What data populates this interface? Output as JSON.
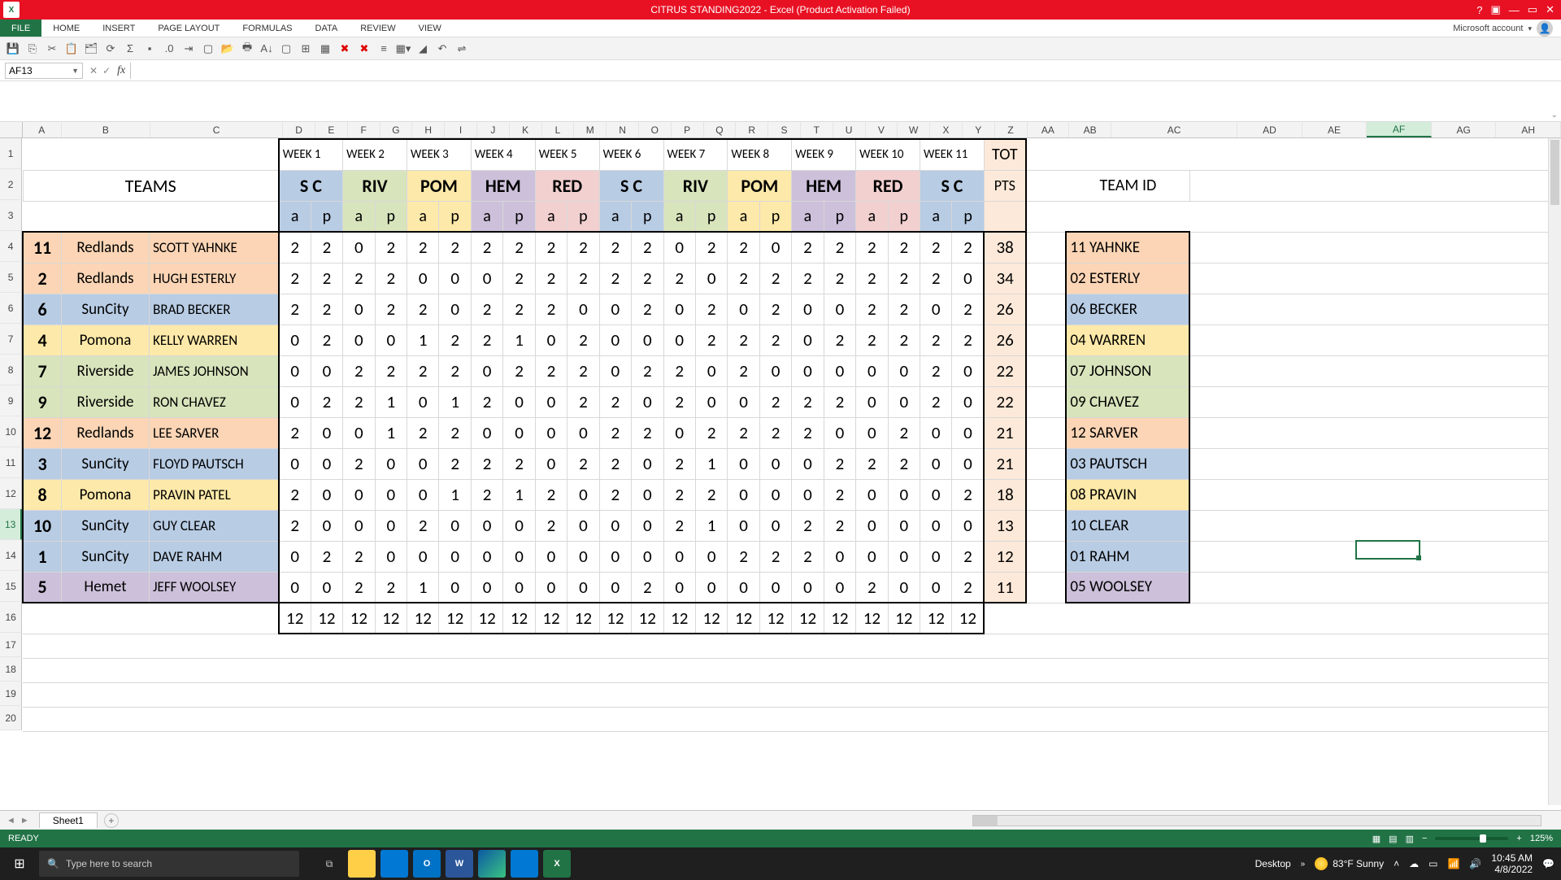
{
  "titlebar": {
    "title": "CITRUS STANDING2022 - Excel (Product Activation Failed)"
  },
  "ribbon": {
    "file": "FILE",
    "tabs": [
      "HOME",
      "INSERT",
      "PAGE LAYOUT",
      "FORMULAS",
      "DATA",
      "REVIEW",
      "VIEW"
    ],
    "account": "Microsoft account"
  },
  "namebox": "AF13",
  "columns": [
    "A",
    "B",
    "C",
    "D",
    "E",
    "F",
    "G",
    "H",
    "I",
    "J",
    "K",
    "L",
    "M",
    "N",
    "O",
    "P",
    "Q",
    "R",
    "S",
    "T",
    "U",
    "V",
    "W",
    "X",
    "Y",
    "Z",
    "AA",
    "AB",
    "AC",
    "AD",
    "AE",
    "AF",
    "AG",
    "AH"
  ],
  "row_numbers": [
    "1",
    "2",
    "3",
    "4",
    "5",
    "6",
    "7",
    "8",
    "9",
    "10",
    "11",
    "12",
    "13",
    "14",
    "15",
    "16",
    "17",
    "18",
    "19",
    "20"
  ],
  "selected_col": "AF",
  "selected_row": "13",
  "header": {
    "teams_label": "TEAMS",
    "weeks": [
      "WEEK 1",
      "WEEK 2",
      "WEEK 3",
      "WEEK 4",
      "WEEK 5",
      "WEEK 6",
      "WEEK 7",
      "WEEK 8",
      "WEEK 9",
      "WEEK 10",
      "WEEK 11"
    ],
    "locations": [
      "S C",
      "RIV",
      "POM",
      "HEM",
      "RED",
      "S C",
      "RIV",
      "POM",
      "HEM",
      "RED",
      "S C"
    ],
    "a": "a",
    "p": "p",
    "tot": "TOT",
    "pts": "PTS",
    "team_id": "TEAM ID"
  },
  "rows": [
    {
      "num": "11",
      "city": "Redlands",
      "name": "SCOTT YAHNKE",
      "scores": [
        2,
        2,
        0,
        2,
        2,
        2,
        2,
        2,
        2,
        2,
        2,
        2,
        0,
        2,
        2,
        0,
        2,
        2,
        2,
        2,
        2,
        2
      ],
      "tot": "38",
      "id": "11 YAHNKE",
      "fill": "f-orange"
    },
    {
      "num": "2",
      "city": "Redlands",
      "name": "HUGH ESTERLY",
      "scores": [
        2,
        2,
        2,
        2,
        0,
        0,
        0,
        2,
        2,
        2,
        2,
        2,
        2,
        0,
        2,
        2,
        2,
        2,
        2,
        2,
        2,
        0
      ],
      "tot": "34",
      "id": "02 ESTERLY",
      "fill": "f-orange"
    },
    {
      "num": "6",
      "city": "SunCity",
      "name": "BRAD BECKER",
      "scores": [
        2,
        2,
        0,
        2,
        2,
        0,
        2,
        2,
        2,
        0,
        0,
        2,
        0,
        2,
        0,
        2,
        0,
        0,
        2,
        2,
        0,
        2
      ],
      "tot": "26",
      "id": "06 BECKER",
      "fill": "f-blue"
    },
    {
      "num": "4",
      "city": "Pomona",
      "name": "KELLY WARREN",
      "scores": [
        0,
        2,
        0,
        0,
        1,
        2,
        2,
        1,
        0,
        2,
        0,
        0,
        0,
        2,
        2,
        2,
        0,
        2,
        2,
        2,
        2,
        2
      ],
      "tot": "26",
      "id": "04 WARREN",
      "fill": "f-yellow"
    },
    {
      "num": "7",
      "city": "Riverside",
      "name": "JAMES JOHNSON",
      "scores": [
        0,
        0,
        2,
        2,
        2,
        2,
        0,
        2,
        2,
        2,
        0,
        2,
        2,
        0,
        2,
        0,
        0,
        0,
        0,
        0,
        2,
        0
      ],
      "tot": "22",
      "id": "07 JOHNSON",
      "fill": "f-green"
    },
    {
      "num": "9",
      "city": "Riverside",
      "name": "RON CHAVEZ",
      "scores": [
        0,
        2,
        2,
        1,
        0,
        1,
        2,
        0,
        0,
        2,
        2,
        0,
        2,
        0,
        0,
        2,
        2,
        2,
        0,
        0,
        2,
        0
      ],
      "tot": "22",
      "id": "09 CHAVEZ",
      "fill": "f-green"
    },
    {
      "num": "12",
      "city": "Redlands",
      "name": "LEE SARVER",
      "scores": [
        2,
        0,
        0,
        1,
        2,
        2,
        0,
        0,
        0,
        0,
        2,
        2,
        0,
        2,
        2,
        2,
        2,
        0,
        0,
        2,
        0,
        0
      ],
      "tot": "21",
      "id": "12 SARVER",
      "fill": "f-orange"
    },
    {
      "num": "3",
      "city": "SunCity",
      "name": "FLOYD PAUTSCH",
      "scores": [
        0,
        0,
        2,
        0,
        0,
        2,
        2,
        2,
        0,
        2,
        2,
        0,
        2,
        1,
        0,
        0,
        0,
        2,
        2,
        2,
        0,
        0
      ],
      "tot": "21",
      "id": "03 PAUTSCH",
      "fill": "f-blue"
    },
    {
      "num": "8",
      "city": "Pomona",
      "name": "PRAVIN PATEL",
      "scores": [
        2,
        0,
        0,
        0,
        0,
        1,
        2,
        1,
        2,
        0,
        2,
        0,
        2,
        2,
        0,
        0,
        0,
        2,
        0,
        0,
        0,
        2
      ],
      "tot": "18",
      "id": "08 PRAVIN",
      "fill": "f-yellow"
    },
    {
      "num": "10",
      "city": "SunCity",
      "name": "GUY CLEAR",
      "scores": [
        2,
        0,
        0,
        0,
        2,
        0,
        0,
        0,
        2,
        0,
        0,
        0,
        2,
        1,
        0,
        0,
        2,
        2,
        0,
        0,
        0,
        0
      ],
      "tot": "13",
      "id": "10 CLEAR",
      "fill": "f-blue"
    },
    {
      "num": "1",
      "city": "SunCity",
      "name": "DAVE RAHM",
      "scores": [
        0,
        2,
        2,
        0,
        0,
        0,
        0,
        0,
        0,
        0,
        0,
        0,
        0,
        0,
        2,
        2,
        2,
        0,
        0,
        0,
        0,
        2
      ],
      "tot": "12",
      "id": "01 RAHM",
      "fill": "f-blue"
    },
    {
      "num": "5",
      "city": "Hemet",
      "name": "JEFF WOOLSEY",
      "scores": [
        0,
        0,
        2,
        2,
        1,
        0,
        0,
        0,
        0,
        0,
        0,
        2,
        0,
        0,
        0,
        0,
        0,
        0,
        2,
        0,
        0,
        2
      ],
      "tot": "11",
      "id": "05 WOOLSEY",
      "fill": "f-lav"
    }
  ],
  "sum_row": [
    12,
    12,
    12,
    12,
    12,
    12,
    12,
    12,
    12,
    12,
    12,
    12,
    12,
    12,
    12,
    12,
    12,
    12,
    12,
    12,
    12,
    12
  ],
  "loc_fills": [
    "f-blue",
    "f-green",
    "f-yellow",
    "f-lav",
    "f-pink",
    "f-blue",
    "f-green",
    "f-yellow",
    "f-lav",
    "f-pink",
    "f-blue"
  ],
  "sheet_tab": "Sheet1",
  "status": {
    "ready": "READY",
    "zoom": "125%"
  },
  "taskbar": {
    "search_placeholder": "Type here to search",
    "desktop": "Desktop",
    "weather": "83°F  Sunny",
    "time": "10:45 AM",
    "date": "4/8/2022"
  }
}
